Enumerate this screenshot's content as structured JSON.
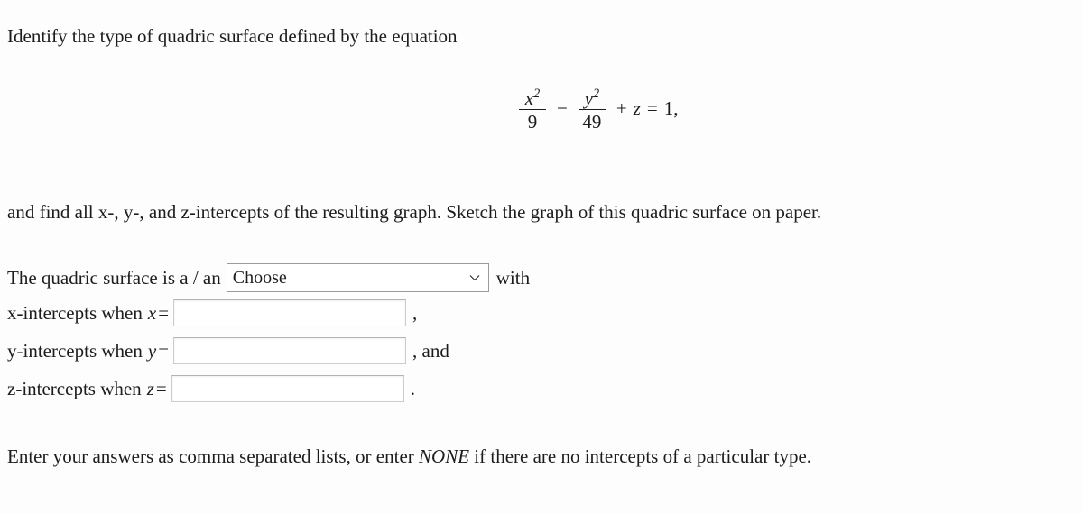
{
  "intro": {
    "text": "Identify the type of quadric surface defined by the equation"
  },
  "equation": {
    "term1_numerator_base": "x",
    "term1_numerator_exponent": "2",
    "term1_denominator": "9",
    "operator1": "−",
    "term2_numerator_base": "y",
    "term2_numerator_exponent": "2",
    "term2_denominator": "49",
    "operator2": "+",
    "term3": "z",
    "equals": "=",
    "right_side": "1",
    "trailing_comma": ",",
    "plain": "x^2/9 - y^2/49 + z = 1,"
  },
  "find": {
    "text": "and find all x-, y-, and z-intercepts of the resulting graph. Sketch the graph of this quadric surface on paper."
  },
  "answers": {
    "surface_prefix": "The quadric surface is a / an",
    "surface_select": {
      "selected": "Choose",
      "options": [
        "Choose"
      ],
      "chevron": "chevron-down-icon"
    },
    "with_word": "with",
    "rows": [
      {
        "label": "x-intercepts when",
        "variable": "x",
        "equals": "=",
        "value": "",
        "placeholder": "",
        "trailing": ","
      },
      {
        "label": "y-intercepts when",
        "variable": "y",
        "equals": "=",
        "value": "",
        "placeholder": "",
        "trailing": ", and"
      },
      {
        "label": "z-intercepts when",
        "variable": "z",
        "equals": "=",
        "value": "",
        "placeholder": "",
        "trailing": "."
      }
    ]
  },
  "note": {
    "before": "Enter your answers as comma separated lists, or enter ",
    "emphasis": "NONE",
    "after": " if there are no intercepts of a particular type."
  },
  "colors": {
    "background": "#fdfdfd",
    "text": "#1c1c1c",
    "input_border": "#cccccc",
    "select_border": "#9a9a9a",
    "input_background": "#ffffff"
  }
}
